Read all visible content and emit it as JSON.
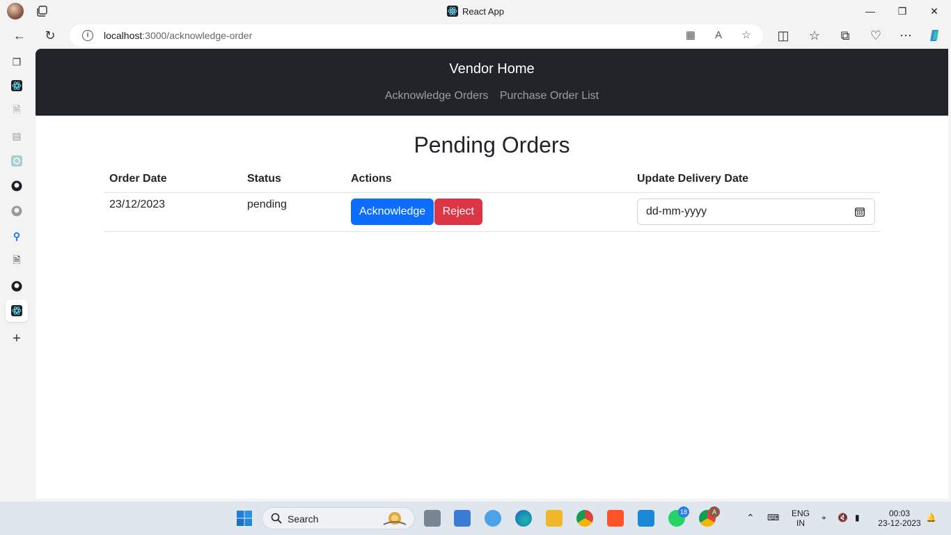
{
  "browser": {
    "tab_title": "React App",
    "url_host": "localhost",
    "url_rest": ":3000/acknowledge-order"
  },
  "navbar": {
    "brand": "Vendor Home",
    "links": [
      "Acknowledge Orders",
      "Purchase Order List"
    ]
  },
  "page": {
    "title": "Pending Orders"
  },
  "table": {
    "headers": [
      "Order Date",
      "Status",
      "Actions",
      "Update Delivery Date"
    ],
    "rows": [
      {
        "order_date": "23/12/2023",
        "status": "pending",
        "acknowledge_label": "Acknowledge",
        "reject_label": "Reject",
        "date_placeholder": "dd-mm-yyyy"
      }
    ]
  },
  "taskbar": {
    "search_label": "Search",
    "whatsapp_badge": "18",
    "chrome_badge": "A",
    "lang_line1": "ENG",
    "lang_line2": "IN",
    "time": "00:03",
    "date": "23-12-2023"
  },
  "colors": {
    "navbar_bg": "#212529",
    "primary": "#0d6efd",
    "danger": "#dc3545"
  }
}
